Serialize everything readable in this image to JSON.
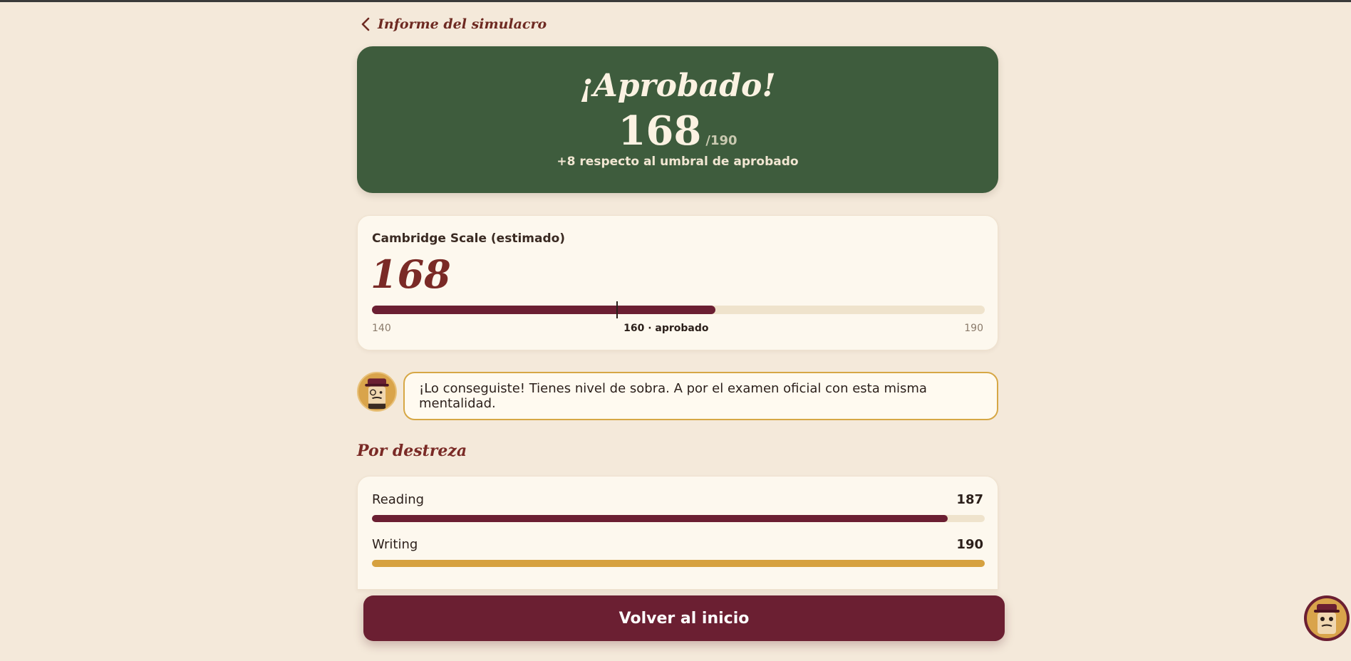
{
  "header": {
    "back_label": "Informe del simulacro"
  },
  "result": {
    "title": "¡Aprobado!",
    "score": "168",
    "score_max": "/190",
    "message": "+8 respecto al umbral de aprobado"
  },
  "scale": {
    "label": "Cambridge Scale (estimado)",
    "value": "168",
    "min_label": "140",
    "pass_label": "160 · aprobado",
    "max_label": "190",
    "min": 140,
    "max": 190,
    "pass": 160,
    "score": 168
  },
  "coach": {
    "message": "¡Lo conseguiste! Tienes nivel de sobra. A por el examen oficial con esta misma mentalidad."
  },
  "skills": {
    "title": "Por destreza",
    "items": [
      {
        "name": "Reading",
        "value": "187",
        "score": 187,
        "color": "#6b1f32"
      },
      {
        "name": "Writing",
        "value": "190",
        "score": 190,
        "color": "#d6a13f"
      }
    ]
  },
  "actions": {
    "home_label": "Volver al inicio"
  },
  "colors": {
    "hero": "#3e5c3d",
    "primary": "#6b1f32",
    "accent": "#d6a13f",
    "background": "#f4e9da"
  }
}
